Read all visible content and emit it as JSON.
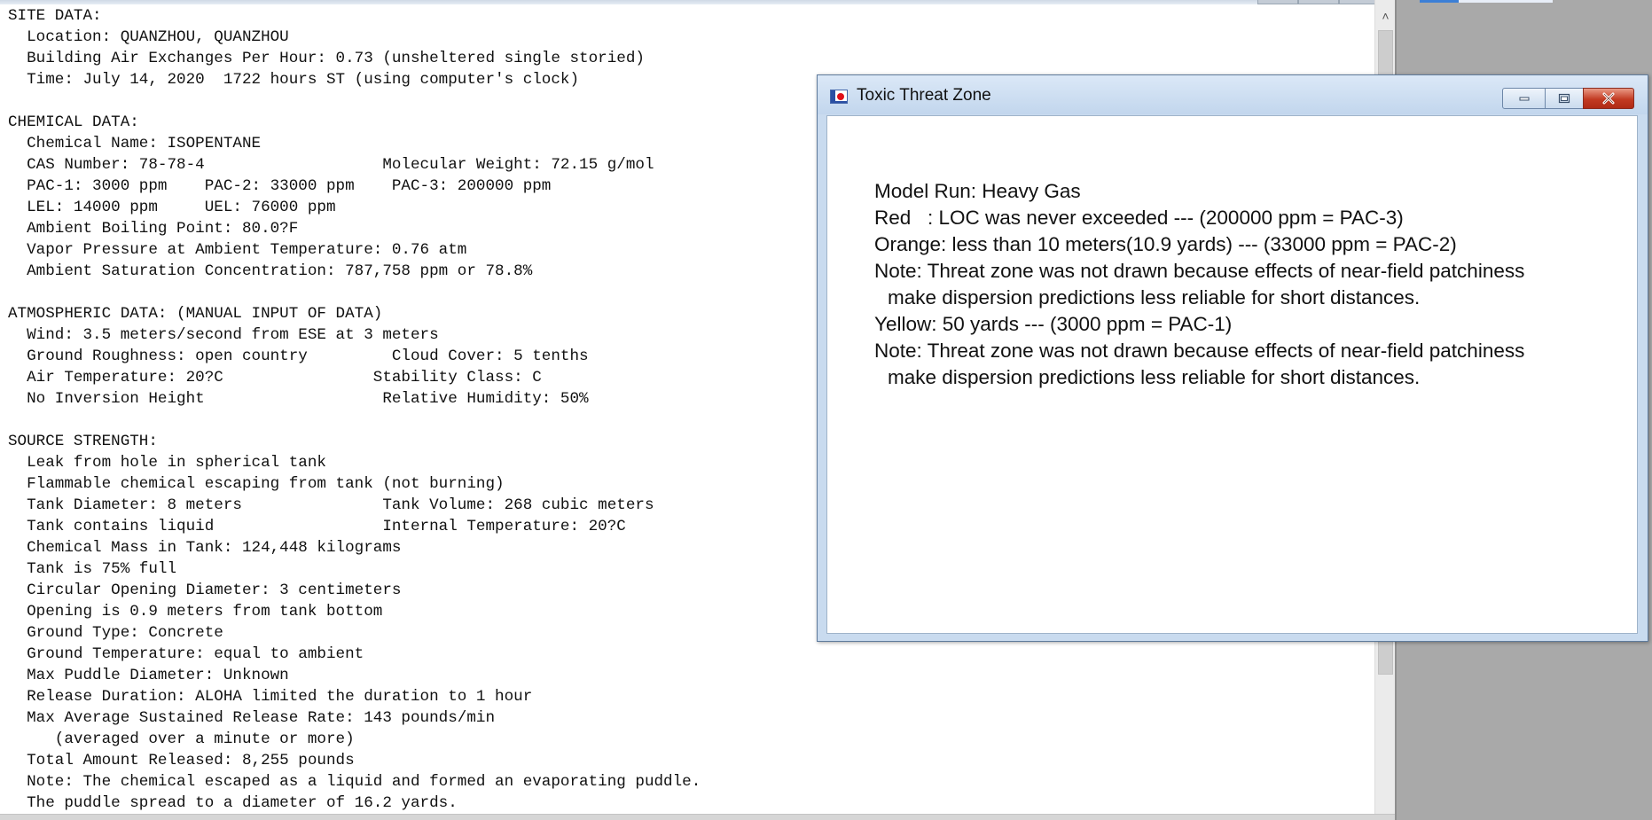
{
  "report": {
    "lines": [
      "SITE DATA:",
      "  Location: QUANZHOU, QUANZHOU",
      "  Building Air Exchanges Per Hour: 0.73 (unsheltered single storied)",
      "  Time: July 14, 2020  1722 hours ST (using computer's clock)",
      "",
      "CHEMICAL DATA:",
      "  Chemical Name: ISOPENTANE",
      "  CAS Number: 78-78-4                   Molecular Weight: 72.15 g/mol",
      "  PAC-1: 3000 ppm    PAC-2: 33000 ppm    PAC-3: 200000 ppm",
      "  LEL: 14000 ppm     UEL: 76000 ppm",
      "  Ambient Boiling Point: 80.0?F",
      "  Vapor Pressure at Ambient Temperature: 0.76 atm",
      "  Ambient Saturation Concentration: 787,758 ppm or 78.8%",
      "",
      "ATMOSPHERIC DATA: (MANUAL INPUT OF DATA)",
      "  Wind: 3.5 meters/second from ESE at 3 meters",
      "  Ground Roughness: open country         Cloud Cover: 5 tenths",
      "  Air Temperature: 20?C                Stability Class: C",
      "  No Inversion Height                   Relative Humidity: 50%",
      "",
      "SOURCE STRENGTH:",
      "  Leak from hole in spherical tank",
      "  Flammable chemical escaping from tank (not burning)",
      "  Tank Diameter: 8 meters               Tank Volume: 268 cubic meters",
      "  Tank contains liquid                  Internal Temperature: 20?C",
      "  Chemical Mass in Tank: 124,448 kilograms",
      "  Tank is 75% full",
      "  Circular Opening Diameter: 3 centimeters",
      "  Opening is 0.9 meters from tank bottom",
      "  Ground Type: Concrete",
      "  Ground Temperature: equal to ambient",
      "  Max Puddle Diameter: Unknown",
      "  Release Duration: ALOHA limited the duration to 1 hour",
      "  Max Average Sustained Release Rate: 143 pounds/min",
      "     (averaged over a minute or more)",
      "  Total Amount Released: 8,255 pounds",
      "  Note: The chemical escaped as a liquid and formed an evaporating puddle.",
      "  The puddle spread to a diameter of 16.2 yards."
    ]
  },
  "dialog": {
    "title": "Toxic Threat Zone",
    "lines": [
      "Model Run: Heavy Gas",
      "Red   : LOC was never exceeded --- (200000 ppm = PAC-3)",
      "Orange: less than 10 meters(10.9 yards) --- (33000 ppm = PAC-2)",
      "Note: Threat zone was not drawn because effects of near-field patchiness",
      "make dispersion predictions less reliable for short distances.",
      "Yellow: 50 yards --- (3000 ppm = PAC-1)",
      "Note: Threat zone was not drawn because effects of near-field patchiness",
      "make dispersion predictions less reliable for short distances."
    ],
    "icons": {
      "app": "aloha-app-icon",
      "minimize": "minimize-icon",
      "maximize": "maximize-icon",
      "close": "close-icon"
    }
  },
  "colors": {
    "close_button": "#c23a22",
    "titlebar": "#c9dbef",
    "desktop_gray": "#a9a9a9"
  }
}
